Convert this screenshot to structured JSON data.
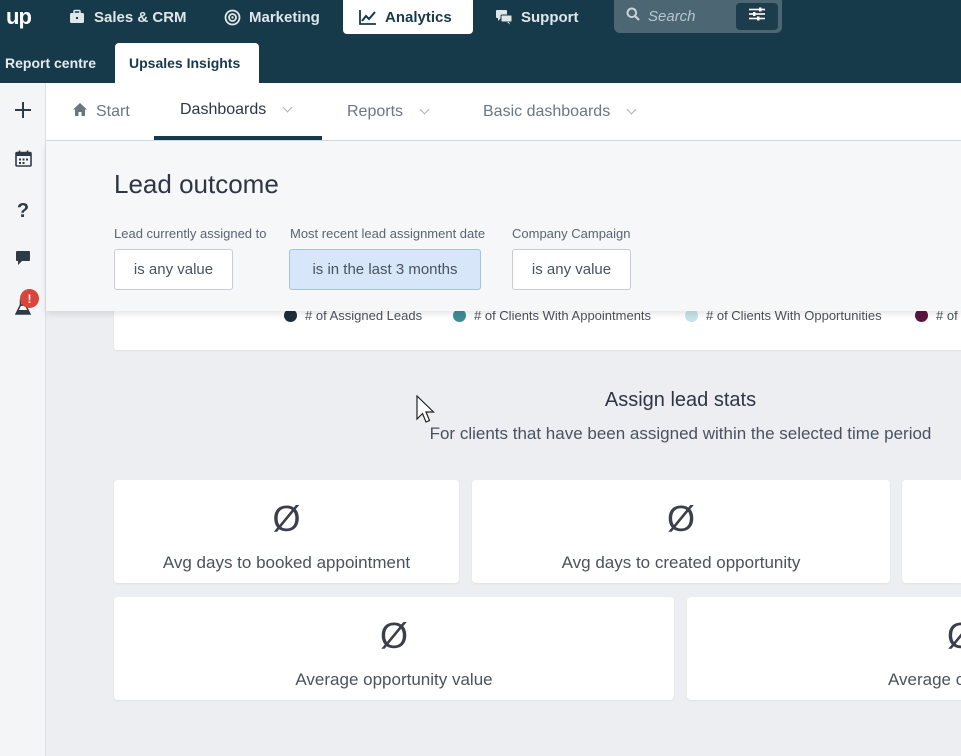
{
  "app": {
    "logo": "up"
  },
  "topnav": [
    {
      "label": "Sales & CRM",
      "icon": "briefcase-icon"
    },
    {
      "label": "Marketing",
      "icon": "target-icon"
    },
    {
      "label": "Analytics",
      "icon": "chart-line-icon",
      "active": true
    },
    {
      "label": "Support",
      "icon": "chat-bubbles-icon"
    }
  ],
  "search": {
    "placeholder": "Search"
  },
  "subnav": [
    {
      "label": "Report centre"
    },
    {
      "label": "Upsales Insights",
      "active": true
    }
  ],
  "rail": {
    "icons": [
      "plus-icon",
      "calendar-icon",
      "help-icon",
      "chat-icon",
      "flask-icon"
    ],
    "alert_badge": "!"
  },
  "tabs": [
    {
      "label": "Start",
      "icon": "home-icon"
    },
    {
      "label": "Dashboards",
      "active": true
    },
    {
      "label": "Reports"
    },
    {
      "label": "Basic dashboards"
    }
  ],
  "page": {
    "title": "Lead outcome"
  },
  "filters": [
    {
      "label": "Lead currently assigned to",
      "value": "is any value"
    },
    {
      "label": "Most recent lead assignment date",
      "value": "is in the last 3 months",
      "selected": true
    },
    {
      "label": "Company Campaign",
      "value": "is any value"
    }
  ],
  "legend": [
    {
      "label": "# of Assigned Leads",
      "color": "#1f2d3a"
    },
    {
      "label": "# of Clients With Appointments",
      "color": "#3f8c98"
    },
    {
      "label": "# of Clients With Opportunities",
      "color": "#c4e3e6"
    },
    {
      "label": "# of",
      "color": "#5a1440"
    }
  ],
  "stats": {
    "title": "Assign lead stats",
    "subtitle": "For clients that have been assigned within the selected time period",
    "cards": [
      {
        "value": "Ø",
        "label": "Avg days to booked appointment"
      },
      {
        "value": "Ø",
        "label": "Avg days to created opportunity"
      },
      {
        "value": "",
        "label": ""
      },
      {
        "value": "Ø",
        "label": "Average opportunity value"
      },
      {
        "value": "Ø",
        "label": "Average c"
      }
    ]
  }
}
